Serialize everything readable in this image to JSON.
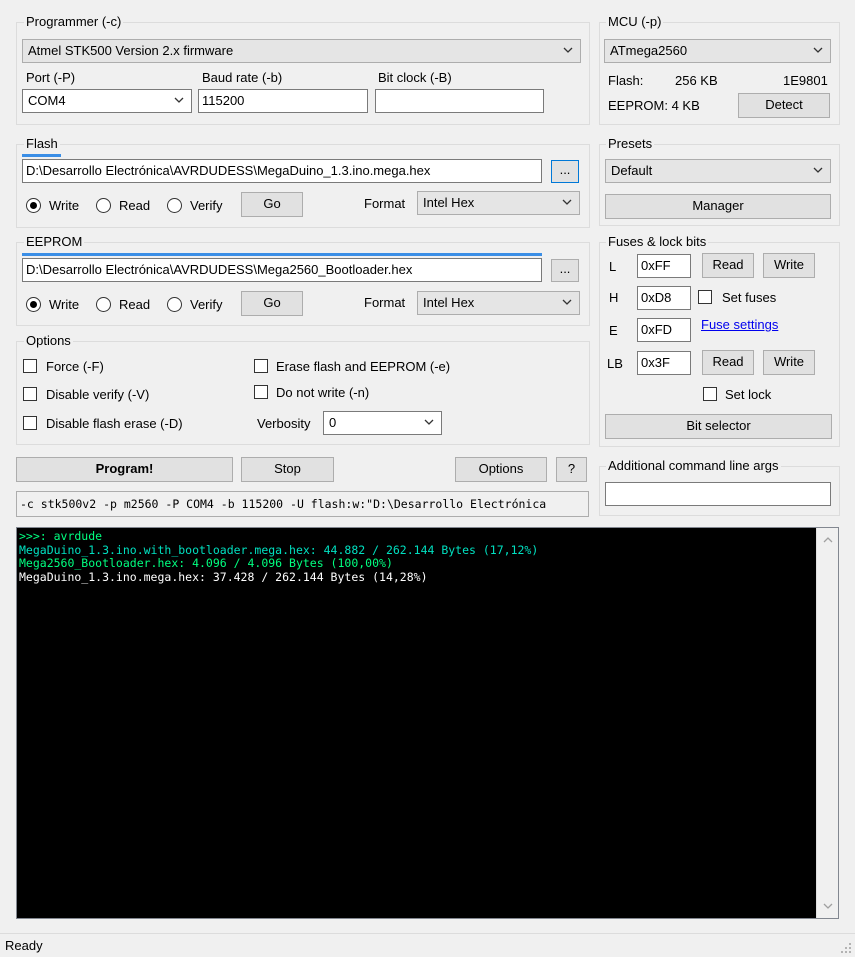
{
  "programmer": {
    "group_label": "Programmer (-c)",
    "selected": "Atmel STK500 Version 2.x firmware",
    "port_label": "Port (-P)",
    "port_value": "COM4",
    "baud_label": "Baud rate (-b)",
    "baud_value": "115200",
    "bitclock_label": "Bit clock (-B)",
    "bitclock_value": ""
  },
  "mcu": {
    "group_label": "MCU (-p)",
    "selected": "ATmega2560",
    "flash_label": "Flash:",
    "flash_size": "256 KB",
    "signature": "1E9801",
    "eeprom_label": "EEPROM: 4 KB",
    "detect_label": "Detect"
  },
  "flash": {
    "group_label": "Flash",
    "path": "D:\\Desarrollo Electrónica\\AVRDUDESS\\MegaDuino_1.3.ino.mega.hex",
    "browse_label": "...",
    "write_label": "Write",
    "read_label": "Read",
    "verify_label": "Verify",
    "go_label": "Go",
    "format_label": "Format",
    "format_value": "Intel Hex",
    "selected_op": "write",
    "progress": 0.14
  },
  "eeprom": {
    "group_label": "EEPROM",
    "path": "D:\\Desarrollo Electrónica\\AVRDUDESS\\Mega2560_Bootloader.hex",
    "browse_label": "...",
    "write_label": "Write",
    "read_label": "Read",
    "verify_label": "Verify",
    "go_label": "Go",
    "format_label": "Format",
    "format_value": "Intel Hex",
    "selected_op": "write",
    "progress": 1.0
  },
  "options": {
    "group_label": "Options",
    "force": "Force (-F)",
    "disable_verify": "Disable verify (-V)",
    "disable_flash_erase": "Disable flash erase (-D)",
    "erase_flash_eeprom": "Erase flash and EEPROM (-e)",
    "do_not_write": "Do not write (-n)",
    "verbosity_label": "Verbosity",
    "verbosity_value": "0"
  },
  "presets": {
    "group_label": "Presets",
    "selected": "Default",
    "manager_label": "Manager"
  },
  "fuses": {
    "group_label": "Fuses & lock bits",
    "l_label": "L",
    "l_value": "0xFF",
    "h_label": "H",
    "h_value": "0xD8",
    "e_label": "E",
    "e_value": "0xFD",
    "lb_label": "LB",
    "lb_value": "0x3F",
    "read_label": "Read",
    "write_label": "Write",
    "set_fuses_label": "Set fuses",
    "fuse_settings_link": "Fuse settings",
    "set_lock_label": "Set lock",
    "bit_selector_label": "Bit selector"
  },
  "actions": {
    "program_label": "Program!",
    "stop_label": "Stop",
    "options_label": "Options",
    "help_label": "?"
  },
  "additional_args": {
    "group_label": "Additional command line args",
    "value": ""
  },
  "command_line": "-c stk500v2 -p m2560 -P COM4 -b 115200 -U flash:w:\"D:\\Desarrollo Electrónica",
  "console": {
    "lines": [
      ">>>: avrdude",
      "MegaDuino_1.3.ino.with_bootloader.mega.hex: 44.882 / 262.144 Bytes (17,12%)",
      "Mega2560_Bootloader.hex: 4.096 / 4.096 Bytes (100,00%)",
      "MegaDuino_1.3.ino.mega.hex: 37.428 / 262.144 Bytes (14,28%)"
    ],
    "colors": [
      "#00ff80",
      "#00e0c0",
      "#00ff80",
      "#ffffff"
    ]
  },
  "status": {
    "text": "Ready"
  },
  "colors": {
    "progress_fill": "#06b025",
    "link": "#0000ee",
    "console_bg": "#000000"
  }
}
